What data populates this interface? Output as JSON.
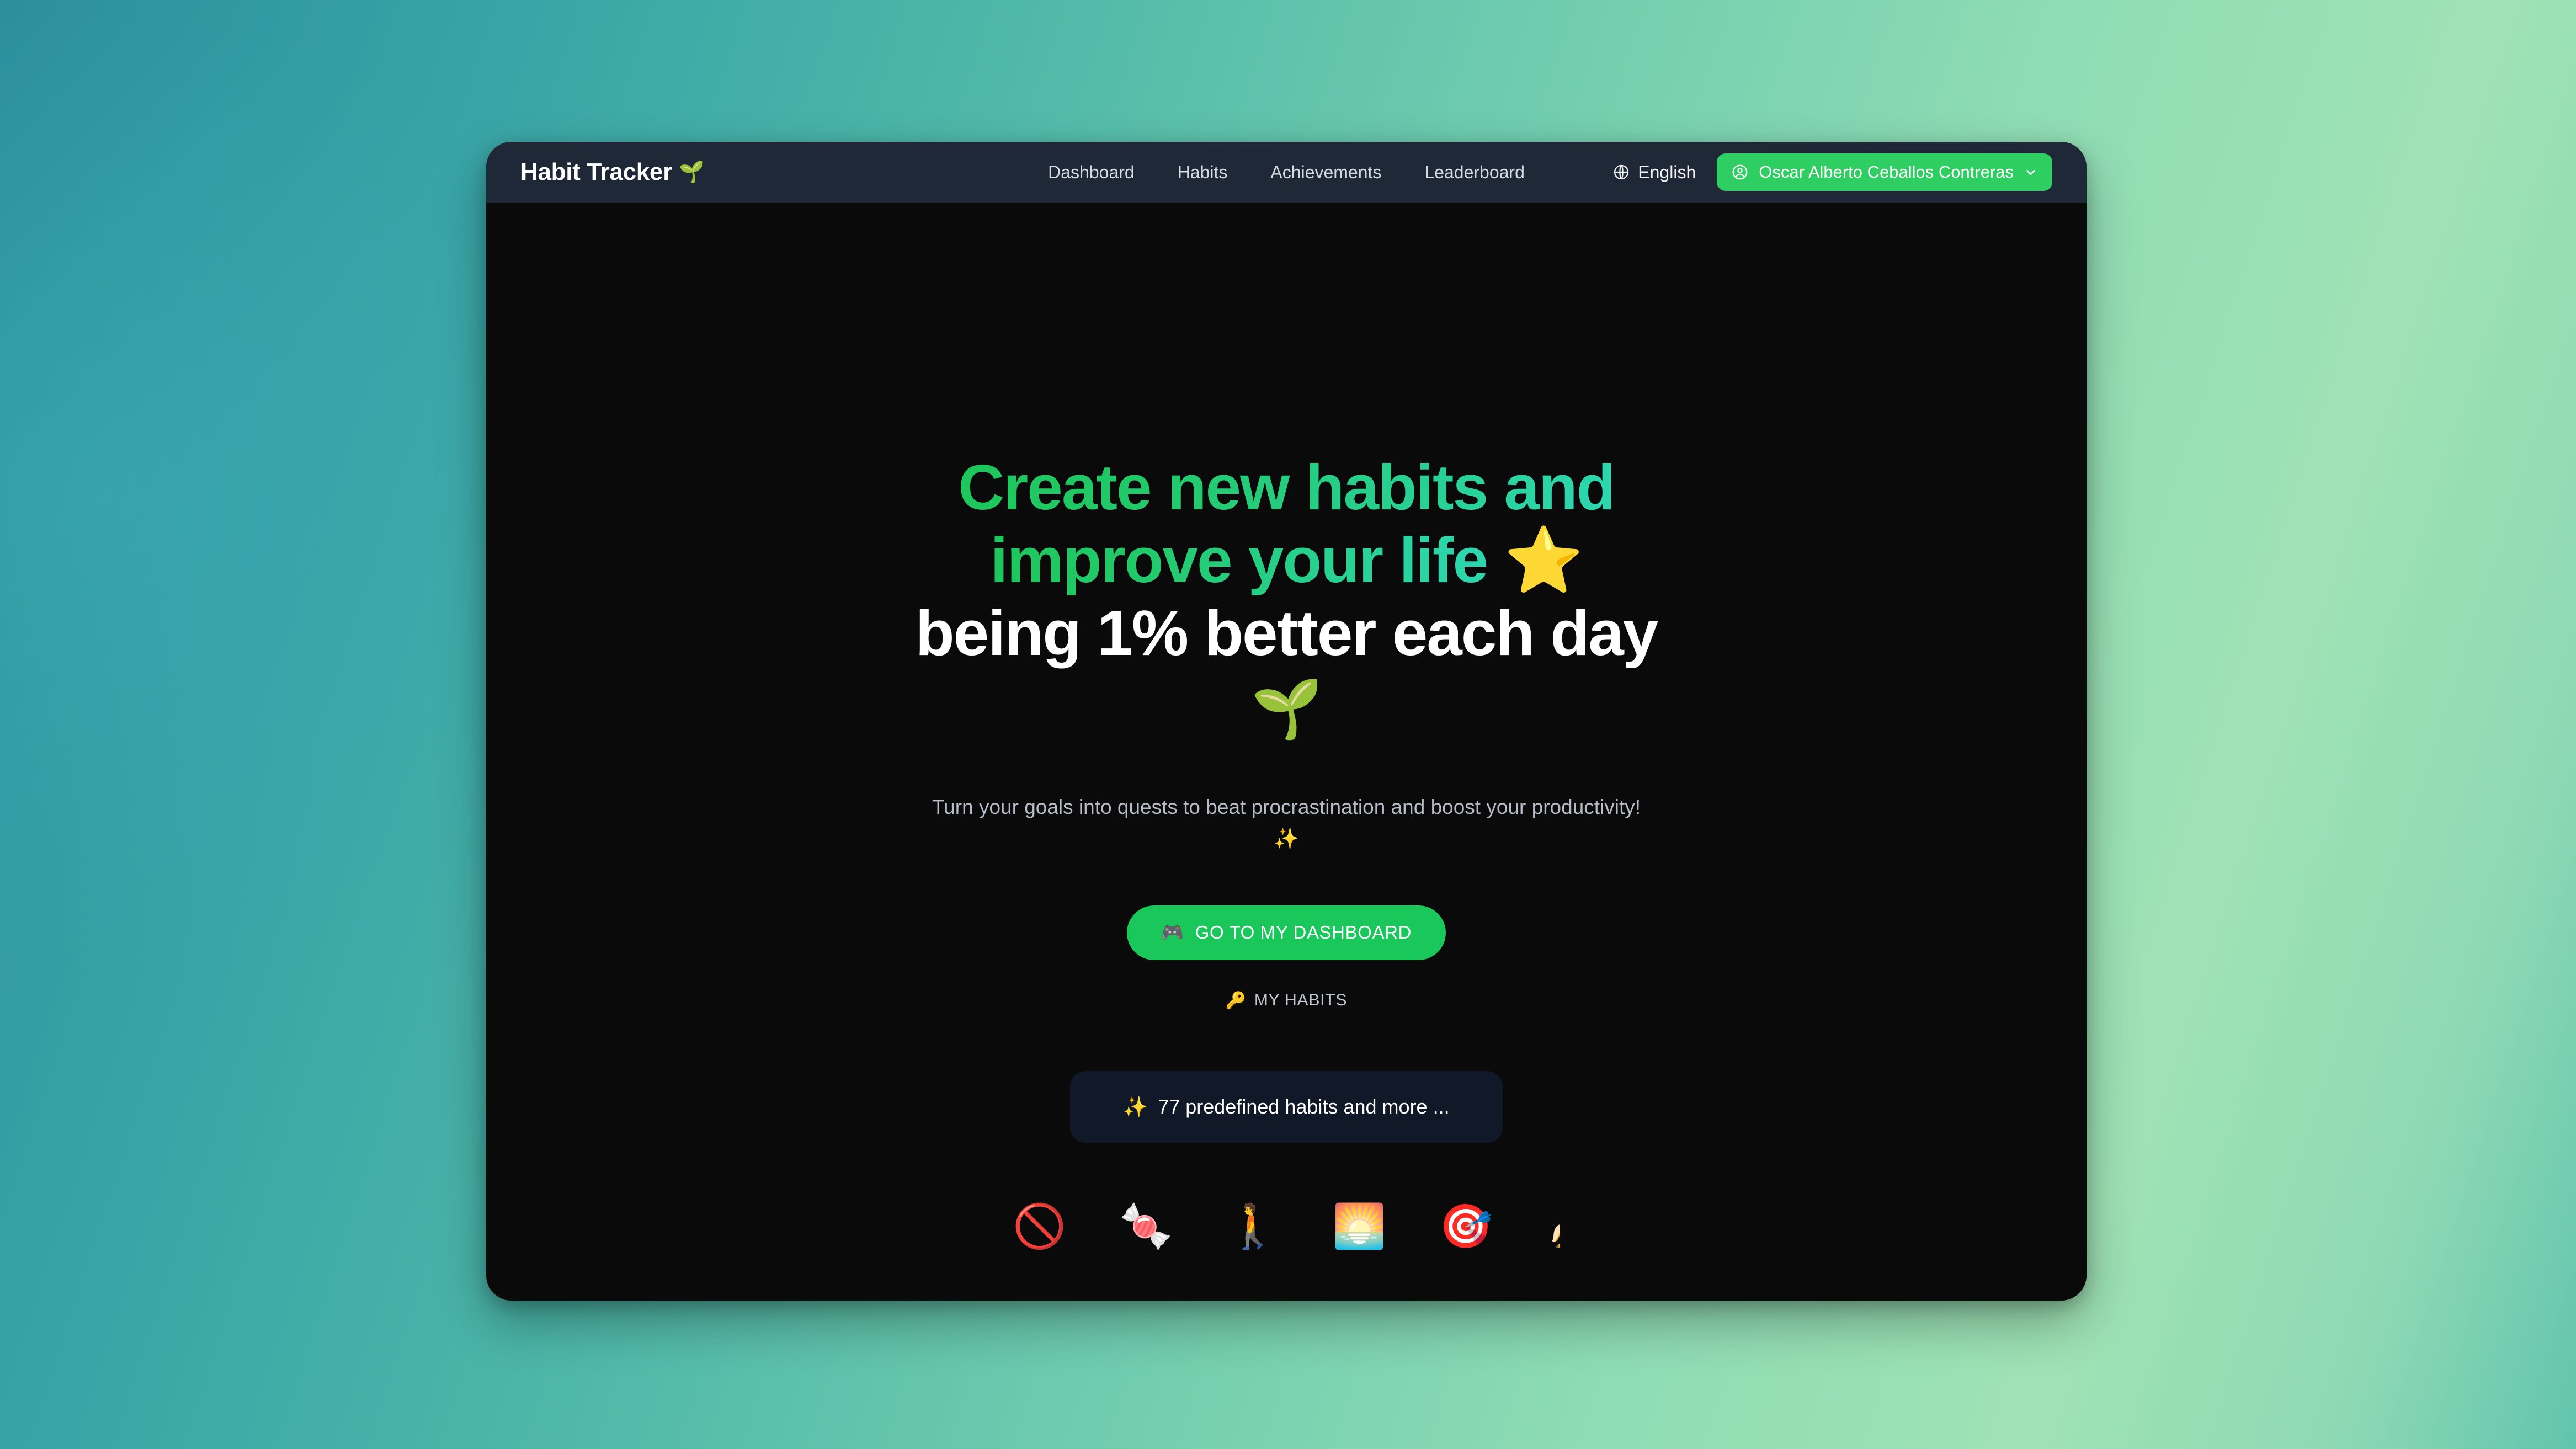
{
  "navbar": {
    "brand": {
      "text": "Habit Tracker",
      "emoji": "🌱"
    },
    "links": [
      {
        "label": "Dashboard"
      },
      {
        "label": "Habits"
      },
      {
        "label": "Achievements"
      },
      {
        "label": "Leaderboard"
      }
    ],
    "language": {
      "label": "English",
      "icon": "globe-icon"
    },
    "user": {
      "name": "Oscar Alberto Ceballos Contreras",
      "avatar_icon": "account-circle-icon",
      "chevron_icon": "chevron-down-icon"
    }
  },
  "hero": {
    "headline_line1": "Create new habits and",
    "headline_line2": "improve your life",
    "headline_star": "⭐",
    "headline_line3": "being 1% better each day",
    "headline_seedling": "🌱",
    "subtitle": "Turn your goals into quests to beat procrastination and boost your productivity!",
    "subtitle_sparkle": "✨",
    "cta": {
      "label": "GO TO MY DASHBOARD",
      "emoji": "🎮"
    },
    "secondary": {
      "label": "MY HABITS",
      "emoji": "🔑"
    },
    "info_card": {
      "emoji": "✨",
      "text": "77 predefined habits and more ..."
    },
    "emoji_strip": [
      "🚫",
      "🍬",
      "🚶",
      "🌅",
      "🎯",
      "🍌"
    ]
  },
  "colors": {
    "accent_green": "#19c75a",
    "nav_green": "#2fce62",
    "nav_bg": "#1f2836",
    "page_bg": "#0a0a0a",
    "card_bg": "#111827",
    "gradient_start": "#2b8f9c",
    "gradient_end": "#9fe2b5"
  }
}
